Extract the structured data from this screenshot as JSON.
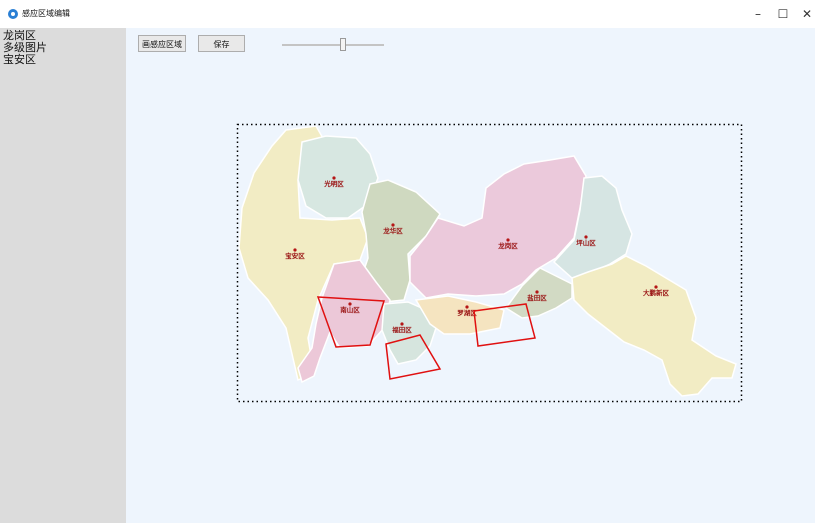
{
  "window": {
    "title": "感应区域编辑",
    "minimize": "–",
    "maximize": "☐",
    "close": "✕"
  },
  "sidebar": {
    "items": [
      {
        "label": "龙岗区"
      },
      {
        "label": "多级图片"
      },
      {
        "label": "宝安区"
      }
    ]
  },
  "toolbar": {
    "draw_label": "画感应区域",
    "save_label": "保存",
    "zoom_level": 0.6
  },
  "map": {
    "districts": [
      {
        "name": "光明区"
      },
      {
        "name": "龙华区"
      },
      {
        "name": "宝安区"
      },
      {
        "name": "南山区"
      },
      {
        "name": "福田区"
      },
      {
        "name": "罗湖区"
      },
      {
        "name": "盐田区"
      },
      {
        "name": "龙岗区"
      },
      {
        "name": "坪山区"
      },
      {
        "name": "大鹏新区"
      }
    ]
  }
}
